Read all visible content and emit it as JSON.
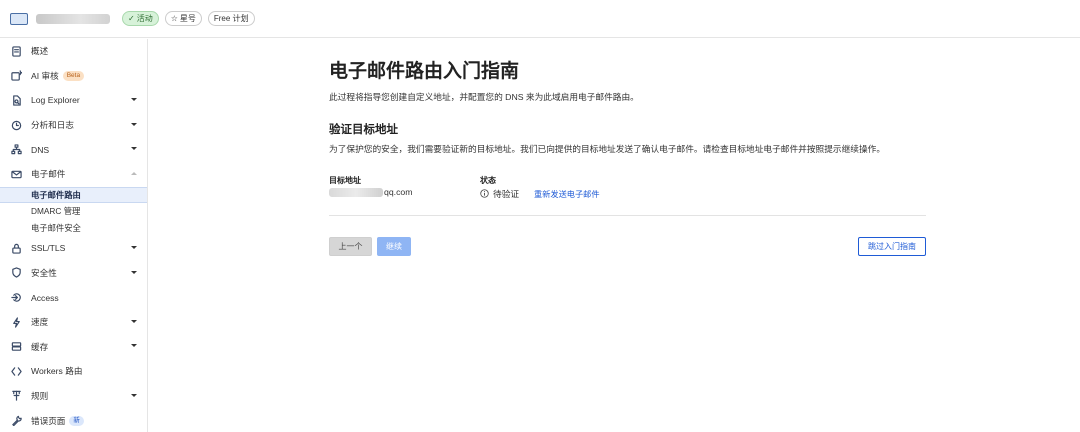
{
  "topbar": {
    "status_label": "活动",
    "star_label": "星号",
    "plan_label": "Free 计划"
  },
  "sidebar": {
    "items": [
      {
        "label": "概述",
        "icon": "document-icon"
      },
      {
        "label": "AI 审核",
        "icon": "ai-audit-icon",
        "badge": "Beta"
      },
      {
        "label": "Log Explorer",
        "icon": "log-icon",
        "expandable": true
      },
      {
        "label": "分析和日志",
        "icon": "clock-icon",
        "expandable": true
      },
      {
        "label": "DNS",
        "icon": "network-icon",
        "expandable": true
      },
      {
        "label": "电子邮件",
        "icon": "mail-icon",
        "expanded": true
      },
      {
        "label": "SSL/TLS",
        "icon": "lock-icon",
        "expandable": true
      },
      {
        "label": "安全性",
        "icon": "shield-icon",
        "expandable": true
      },
      {
        "label": "Access",
        "icon": "access-icon"
      },
      {
        "label": "速度",
        "icon": "lightning-icon",
        "expandable": true
      },
      {
        "label": "缓存",
        "icon": "cache-icon",
        "expandable": true
      },
      {
        "label": "Workers 路由",
        "icon": "workers-icon"
      },
      {
        "label": "规则",
        "icon": "rules-icon",
        "expandable": true
      },
      {
        "label": "错误页面",
        "icon": "wrench-icon",
        "badge": "新"
      }
    ],
    "email_sub": [
      "电子邮件路由",
      "DMARC 管理",
      "电子邮件安全"
    ]
  },
  "main": {
    "title": "电子邮件路由入门指南",
    "description": "此过程将指导您创建自定义地址，并配置您的 DNS 来为此域启用电子邮件路由。",
    "section_title": "验证目标地址",
    "section_desc": "为了保护您的安全，我们需要验证新的目标地址。我们已向提供的目标地址发送了确认电子邮件。请检查目标地址电子邮件并按照提示继续操作。",
    "col_target_label": "目标地址",
    "target_domain": "qq.com",
    "col_status_label": "状态",
    "status_value": "待验证",
    "resend_link": "重新发送电子邮件",
    "btn_prev": "上一个",
    "btn_next": "继续",
    "btn_skip": "跳过入门指南"
  },
  "colors": {
    "accent": "#1f5bd6",
    "active_badge_bg": "#d7f2d9",
    "disabled_primary": "#8fb5f4",
    "selected_nav_bg": "#e8effb"
  }
}
